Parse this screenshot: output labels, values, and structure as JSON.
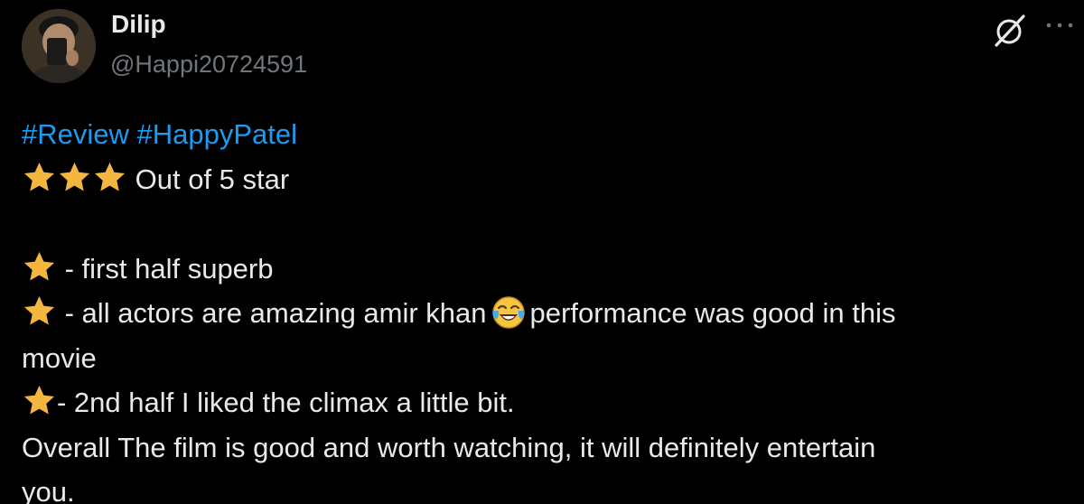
{
  "author": {
    "display_name": "Dilip",
    "handle": "@Happi20724591",
    "avatar_icon": "user-avatar"
  },
  "header_icons": {
    "grok": "grok-icon",
    "more": "more-icon"
  },
  "tweet": {
    "hashtags": [
      "#Review",
      "#HappyPatel"
    ],
    "rating_stars": 3,
    "rating_text": "Out of 5 star",
    "point1": "-  first half superb",
    "point2_a": "- all actors are amazing amir khan",
    "point2_b": "performance was good in this",
    "point2_c": "movie",
    "point3": "- 2nd half I liked the climax a little bit.",
    "overall_a": "Overall The film is good and worth watching, it will definitely entertain",
    "overall_b": "you."
  },
  "colors": {
    "background": "#000000",
    "text": "#e7e9ea",
    "secondary_text": "#71767b",
    "link": "#1d9bf0",
    "star": "#f4b63f"
  }
}
